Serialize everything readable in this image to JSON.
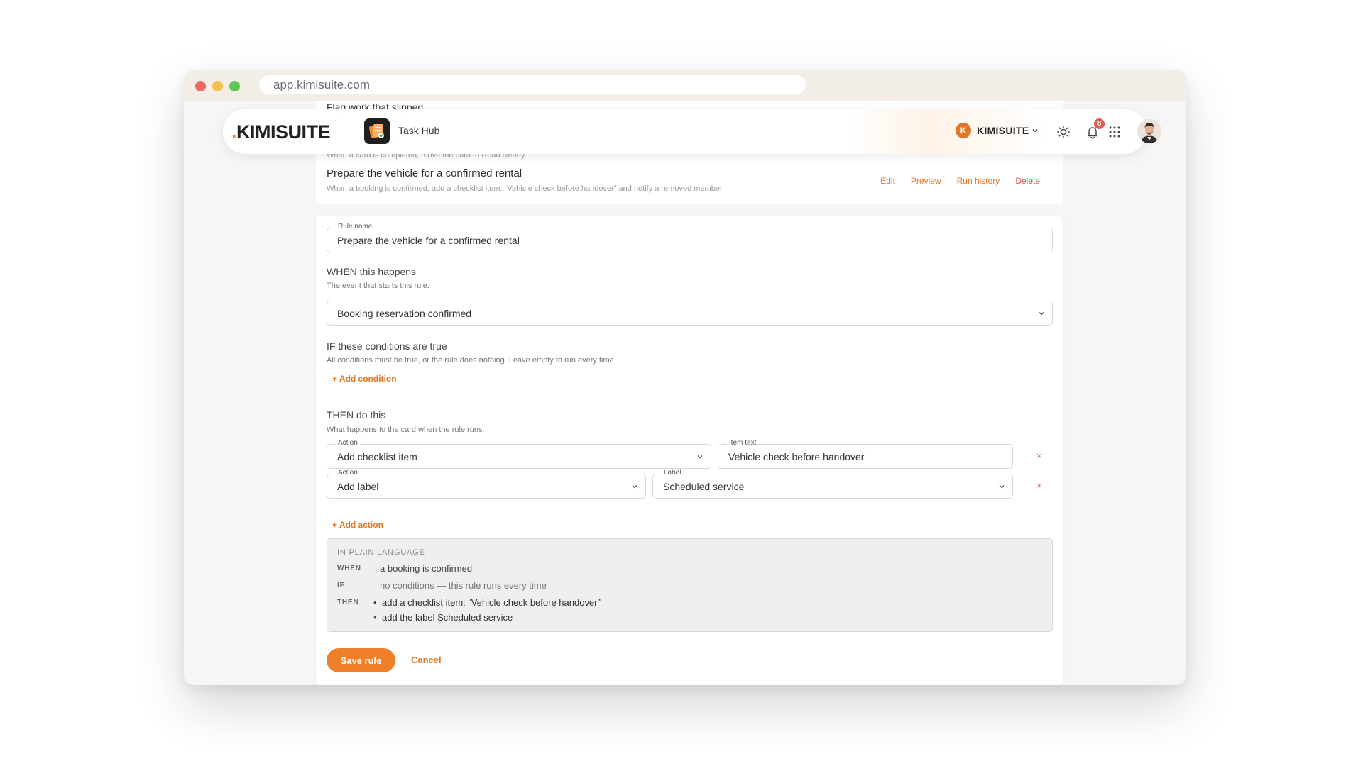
{
  "browser": {
    "url": "app.kimisuite.com"
  },
  "header": {
    "logo_dot": ".",
    "logo_text": "KIMISUITE",
    "app_name": "Task Hub",
    "org_initial": "K",
    "org_name": "KIMISUITE",
    "notification_count": "8",
    "icons": [
      "sun-icon",
      "bell-icon",
      "apps-grid-icon",
      "avatar"
    ]
  },
  "rules_list": {
    "clipped_title": "Flag work that slipped",
    "clipped_desc": "When a card is completed, move the card to Road Ready.",
    "row": {
      "title": "Prepare the vehicle for a confirmed rental",
      "desc": "When a booking is confirmed, add a checklist item: “Vehicle check before handover” and notify a removed member.",
      "actions": {
        "edit": "Edit",
        "preview": "Preview",
        "run_history": "Run history",
        "delete": "Delete"
      }
    }
  },
  "form": {
    "rule_name_label": "Rule name",
    "rule_name_value": "Prepare the vehicle for a confirmed rental",
    "when": {
      "title": "WHEN this happens",
      "sub": "The event that starts this rule.",
      "trigger_value": "Booking reservation confirmed"
    },
    "if": {
      "title": "IF these conditions are true",
      "sub": "All conditions must be true, or the rule does nothing. Leave empty to run every time.",
      "add_condition": "+ Add condition"
    },
    "then": {
      "title": "THEN do this",
      "sub": "What happens to the card when the rule runs.",
      "actions": [
        {
          "action_label": "Action",
          "action_value": "Add checklist item",
          "param_label": "Item text",
          "param_value": "Vehicle check before handover"
        },
        {
          "action_label": "Action",
          "action_value": "Add label",
          "param_label": "Label",
          "param_value": "Scheduled service"
        }
      ],
      "remove_symbol": "×",
      "add_action": "+ Add action"
    },
    "summary": {
      "heading": "IN PLAIN LANGUAGE",
      "when_key": "WHEN",
      "when_val": "a booking is confirmed",
      "if_key": "IF",
      "if_val": "no conditions — this rule runs every time",
      "then_key": "THEN",
      "then_items": [
        "add a checklist item: “Vehicle check before handover”",
        "add the label Scheduled service"
      ]
    },
    "save_label": "Save rule",
    "cancel_label": "Cancel"
  },
  "colors": {
    "accent": "#f07f2a",
    "link": "#e47727",
    "danger": "#d9534f",
    "badge": "#e55a4e"
  }
}
